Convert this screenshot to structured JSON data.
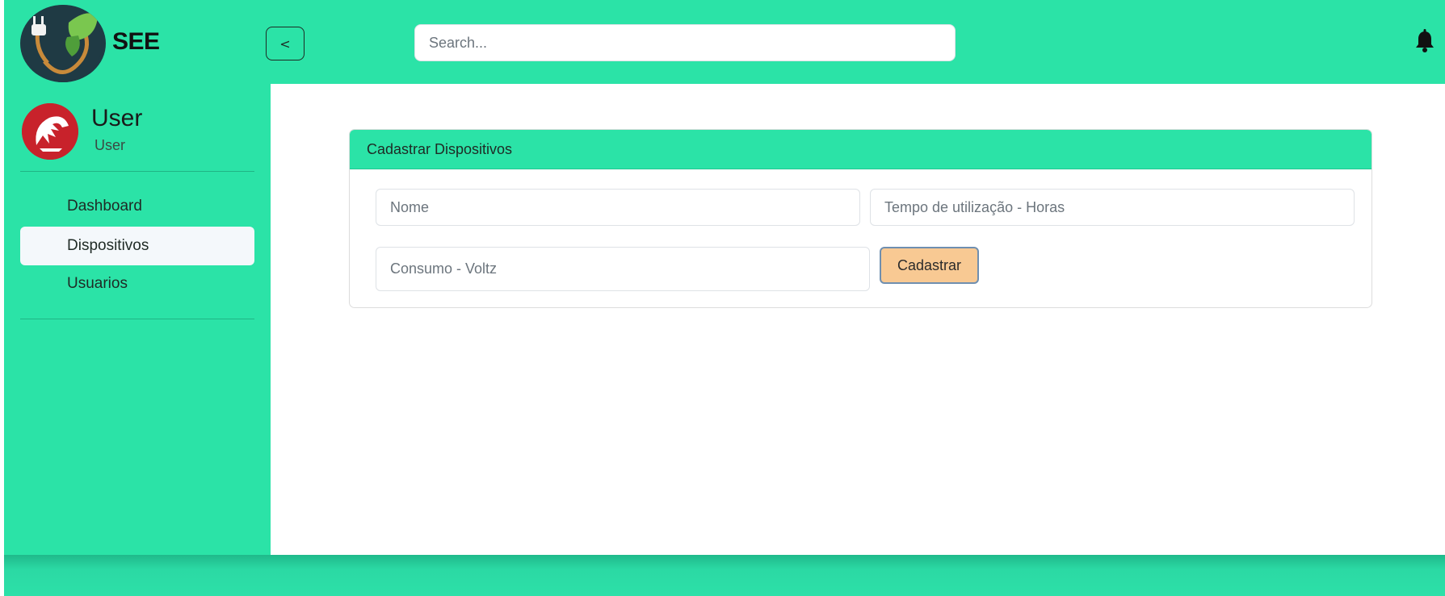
{
  "colors": {
    "accent": "#2be3a7",
    "button": "#f8c993",
    "main_bg": "#ffffff"
  },
  "header": {
    "brand": "SEE",
    "toggle_label": "<",
    "search_placeholder": "Search...",
    "notification_icon": "bell-icon",
    "logo_icon": "plug-leaf-logo"
  },
  "sidebar": {
    "user": {
      "name": "User",
      "role": "User",
      "avatar_icon": "delphi-helmet-avatar"
    },
    "items": [
      {
        "label": "Dashboard",
        "active": false
      },
      {
        "label": "Dispositivos",
        "active": true
      },
      {
        "label": "Usuarios",
        "active": false
      }
    ]
  },
  "form": {
    "title": "Cadastrar Dispositivos",
    "nome_placeholder": "Nome",
    "tempo_placeholder": "Tempo de utilização - Horas",
    "consumo_placeholder": "Consumo - Voltz",
    "submit_label": "Cadastrar"
  }
}
